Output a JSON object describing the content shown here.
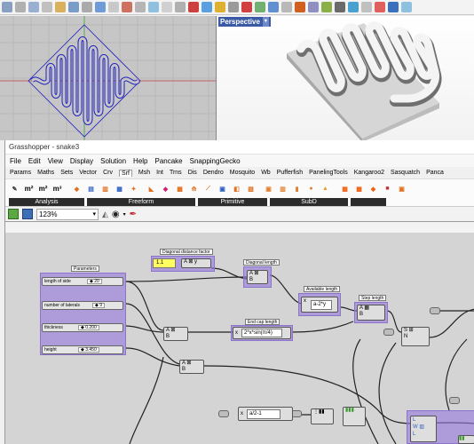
{
  "viewport_top": {},
  "viewport_perspective": {
    "label": "Perspective",
    "dropdown": "▾"
  },
  "gh": {
    "title": "Grasshopper - snake3",
    "menu": [
      "File",
      "Edit",
      "View",
      "Display",
      "Solution",
      "Help",
      "Pancake",
      "SnappingGecko"
    ],
    "tabs": [
      "Params",
      "Maths",
      "Sets",
      "Vector",
      "Crv",
      "Srf",
      "Msh",
      "Int",
      "Trns",
      "Dis",
      "Dendro",
      "Mosquito",
      "Wb",
      "Pufferfish",
      "PanelingTools",
      "Kangaroo2",
      "Sasquatch",
      "Panca"
    ],
    "active_tab": "Srf",
    "groups": [
      "Analysis",
      "Freeform",
      "Primitive",
      "SubD"
    ],
    "zoom": "123%"
  },
  "canvas": {
    "parameters_label": "Parameters",
    "sliders": [
      {
        "name": "length of side",
        "value": "◆ 20"
      },
      {
        "name": "number of laterals",
        "value": "◆ 9"
      },
      {
        "name": "thickness",
        "value": "◆ 0.200"
      },
      {
        "name": "height",
        "value": "◆ 3.450"
      }
    ],
    "diag_factor_label": "Diagonal distance factor",
    "diag_factor_value": "1.1",
    "diag_length_label": "Diagonal length",
    "avail_length_label": "Available length",
    "avail_expr": "a-2*y",
    "step_length_label": "Step length",
    "endcap_label": "End cap length",
    "endcap_expr": "2*x*sin(π/4)",
    "div_expr": "a/2-1"
  },
  "colors": {
    "group": "#9678dc",
    "accent": "#3a5aa5"
  }
}
